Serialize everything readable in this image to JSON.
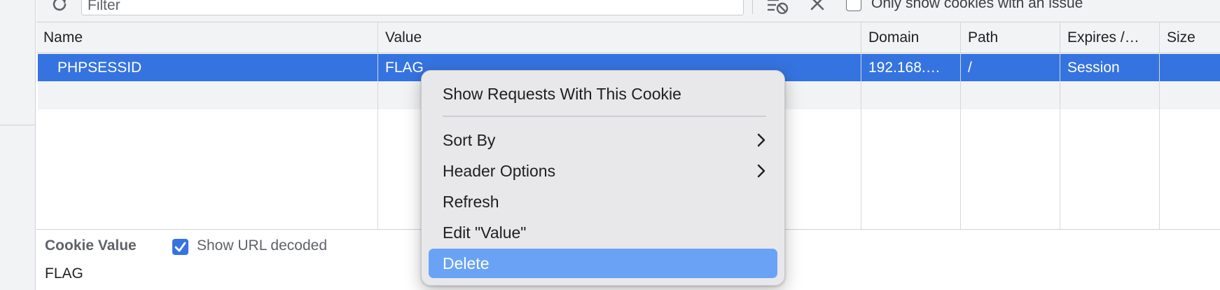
{
  "toolbar": {
    "filter_placeholder": "Filter",
    "only_issue_label": "Only show cookies with an issue"
  },
  "table": {
    "columns": [
      "Name",
      "Value",
      "Domain",
      "Path",
      "Expires /…",
      "Size"
    ],
    "rows": [
      {
        "name": "PHPSESSID",
        "value": "FLAG",
        "domain": "192.168.…",
        "path": "/",
        "expires": "Session",
        "size": ""
      }
    ]
  },
  "context_menu": {
    "items": [
      {
        "label": "Show Requests With This Cookie",
        "submenu": false
      },
      {
        "label": "Sort By",
        "submenu": true
      },
      {
        "label": "Header Options",
        "submenu": true
      },
      {
        "label": "Refresh",
        "submenu": false
      },
      {
        "label": "Edit \"Value\"",
        "submenu": false
      },
      {
        "label": "Delete",
        "submenu": false,
        "highlighted": true
      }
    ]
  },
  "cookie_pane": {
    "title": "Cookie Value",
    "decode_label": "Show URL decoded",
    "decode_checked": true,
    "value": "FLAG"
  },
  "colors": {
    "selection": "#3573e0",
    "menu_highlight": "#6aa3f5",
    "menu_bg": "#e8e7ea"
  },
  "icons": [
    "refresh-icon",
    "clear-filter-icon",
    "close-icon",
    "chevron-right-icon",
    "checkmark-icon"
  ]
}
